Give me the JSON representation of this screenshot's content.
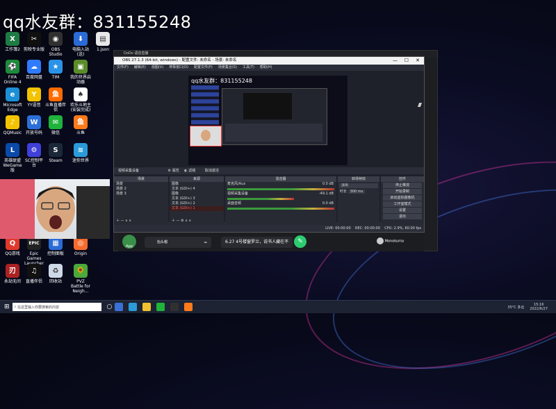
{
  "banner": {
    "text": "qq水友群：831155248"
  },
  "desktop_icons": [
    {
      "label": "工作簿2",
      "color": "#1e7b43",
      "glyph": "X"
    },
    {
      "label": "剪映专业版",
      "color": "#101010",
      "glyph": "✂"
    },
    {
      "label": "OBS Studio",
      "color": "#303030",
      "glyph": "◉"
    },
    {
      "label": "电脑入站(送)",
      "color": "#2a6bd6",
      "glyph": "⬇"
    },
    {
      "label": "1.json",
      "color": "#e8e8e8",
      "glyph": "▤"
    },
    {
      "label": "FIFA Online 4",
      "color": "#1a8c3a",
      "glyph": "⚽"
    },
    {
      "label": "百度网盘",
      "color": "#2f7bff",
      "glyph": "☁"
    },
    {
      "label": "TIM",
      "color": "#2a93e8",
      "glyph": "★"
    },
    {
      "label": "我的世界启动器",
      "color": "#5a8c2a",
      "glyph": "▣"
    },
    {
      "label": "Microsoft Edge",
      "color": "#1d8fd6",
      "glyph": "e"
    },
    {
      "label": "YY语音",
      "color": "#f2c300",
      "glyph": "Y"
    },
    {
      "label": "斗鱼直播伴侣",
      "color": "#ff6a00",
      "glyph": "鱼"
    },
    {
      "label": "欢乐斗地主(安装完成)",
      "color": "#ffffff",
      "glyph": "♠"
    },
    {
      "label": "QQMusic",
      "color": "#f5c400",
      "glyph": "♪"
    },
    {
      "label": "开放号码",
      "color": "#2c6fd8",
      "glyph": "W"
    },
    {
      "label": "微信",
      "color": "#1fb33c",
      "glyph": "✉"
    },
    {
      "label": "斗鱼",
      "color": "#ff7a1a",
      "glyph": "鱼"
    },
    {
      "label": "英雄联盟WeGame版",
      "color": "#0a4aa8",
      "glyph": "L"
    },
    {
      "label": "SC控制平台",
      "color": "#3f3fd9",
      "glyph": "⚙"
    },
    {
      "label": "Steam",
      "color": "#1b2838",
      "glyph": "S"
    },
    {
      "label": "迷你世界",
      "color": "#2a9bd8",
      "glyph": "≋"
    },
    {
      "label": "QQ游戏",
      "color": "#e0392c",
      "glyph": "Q"
    },
    {
      "label": "Epic Games Launcher",
      "color": "#222222",
      "glyph": "EPIC"
    },
    {
      "label": "控制面板",
      "color": "#2a6bd6",
      "glyph": "▦"
    },
    {
      "label": "Origin",
      "color": "#f56c2d",
      "glyph": "◎"
    },
    {
      "label": "永劫无间",
      "color": "#aa2222",
      "glyph": "刃"
    },
    {
      "label": "直播伴侣",
      "color": "#111111",
      "glyph": "♫"
    },
    {
      "label": "回收站",
      "color": "#cfd8e6",
      "glyph": "♻"
    },
    {
      "label": "PVZ Battle for Neigh...",
      "color": "#4aa83c",
      "glyph": "🌻"
    }
  ],
  "dodo_window": {
    "title": "DoDo 语音直播"
  },
  "obs": {
    "title": "OBS 27.1.3 (64-bit, windows) - 配置文件: 未命名 - 场景: 未命名",
    "menu": [
      "文件(F)",
      "编辑(E)",
      "视图(V)",
      "停靠窗口(D)",
      "配置文件(P)",
      "场景集合(S)",
      "工具(T)",
      "帮助(H)"
    ],
    "source_bar": {
      "label": "视频采集设备",
      "props": "属性",
      "filters": "滤镜",
      "deactivate": "取消激活"
    },
    "scenes_header": "场景",
    "scenes": [
      "场景",
      "场景 2",
      "场景 3"
    ],
    "sources_header": "来源",
    "sources": [
      "图像",
      "文本 (GDI+) 4",
      "图像",
      "文本 (GDI+) 3",
      "文本 (GDI+) 2",
      "文本 (GDI+) 1"
    ],
    "mixer_header": "混音器",
    "mixer": [
      {
        "name": "麦克风/Aux",
        "db": "0.0 dB"
      },
      {
        "name": "视频采集设备",
        "db": "-49.1 dB"
      },
      {
        "name": "桌面音频",
        "db": "0.0 dB"
      }
    ],
    "transition_header": "转场特效",
    "transition": {
      "type": "淡出",
      "duration_label": "时长",
      "duration": "300 ms"
    },
    "controls_header": "控件",
    "controls": [
      "停止推流",
      "开始录制",
      "启动虚拟摄像机",
      "工作室模式",
      "设置",
      "退出"
    ],
    "status": {
      "live": "LIVE: 00:00:00",
      "rec": "REC: 00:00:00",
      "cpu": "CPU: 2.9%, 60.00 fps"
    }
  },
  "chat": {
    "message": "6.27 4号楼窗罗兰，说书人藏在不",
    "stream_label": "抬头帽",
    "app_label": "App",
    "user": "Monokuma"
  },
  "taskbar": {
    "search_placeholder": "在这里输入你要搜索的内容",
    "weather": "35°C 多云",
    "time": "15:16",
    "date": "2022/6/27"
  }
}
